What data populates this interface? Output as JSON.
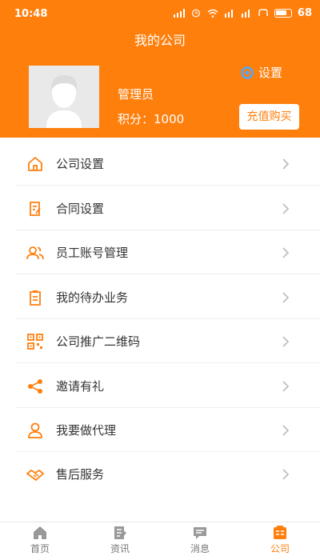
{
  "status_bar": {
    "time": "10:48",
    "battery": "68"
  },
  "header": {
    "title": "我的公司",
    "settings_label": "设置",
    "username": "管理员",
    "points": "积分：1000",
    "recharge_label": "充值购买"
  },
  "colors": {
    "accent": "#ff7f0d",
    "text": "#333333",
    "muted": "#777777"
  },
  "menu": {
    "items": [
      {
        "label": "公司设置",
        "icon": "home-icon"
      },
      {
        "label": "合同设置",
        "icon": "contract-icon"
      },
      {
        "label": "员工账号管理",
        "icon": "users-icon"
      },
      {
        "label": "我的待办业务",
        "icon": "clipboard-icon"
      },
      {
        "label": "公司推广二维码",
        "icon": "qrcode-icon"
      },
      {
        "label": "邀请有礼",
        "icon": "share-icon"
      },
      {
        "label": "我要做代理",
        "icon": "person-icon"
      },
      {
        "label": "售后服务",
        "icon": "handshake-icon"
      }
    ]
  },
  "tabbar": {
    "tabs": [
      {
        "label": "首页",
        "icon": "home-tab-icon"
      },
      {
        "label": "资讯",
        "icon": "news-tab-icon"
      },
      {
        "label": "消息",
        "icon": "message-tab-icon"
      },
      {
        "label": "公司",
        "icon": "company-tab-icon",
        "active": true
      }
    ]
  }
}
